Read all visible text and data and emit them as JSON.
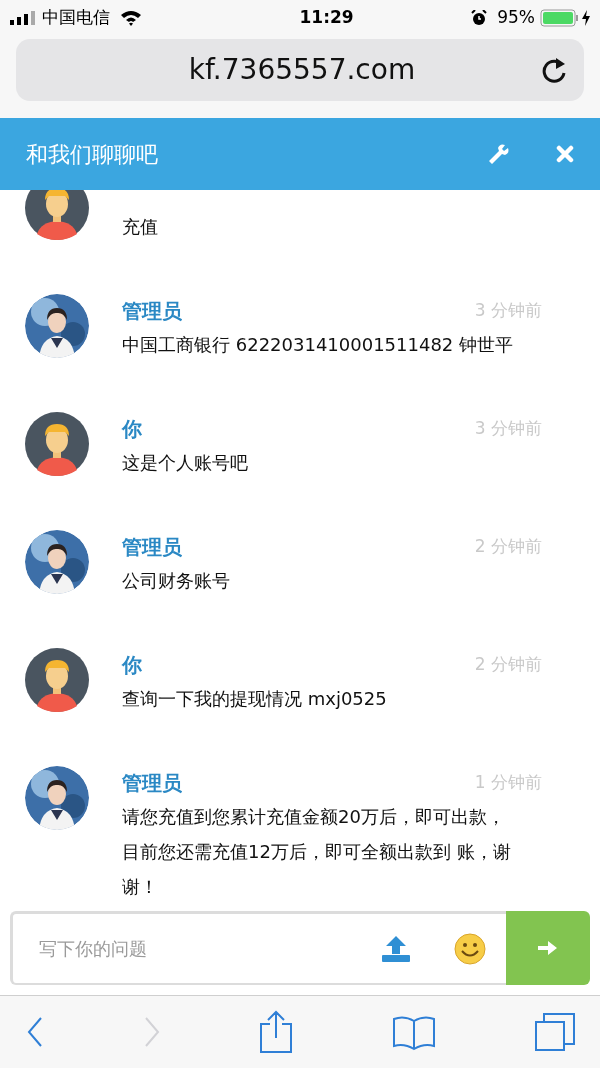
{
  "status_bar": {
    "carrier": "中国电信",
    "time": "11:29",
    "battery": "95%"
  },
  "address_bar": {
    "url": "kf.7365557.com"
  },
  "chat_header": {
    "title": "和我们聊聊吧"
  },
  "messages": [
    {
      "kind": "user",
      "text": "充值"
    },
    {
      "kind": "admin",
      "name": "管理员",
      "time": "3 分钟前",
      "text": "中国工商银行 6222031410001511482 钟世平"
    },
    {
      "kind": "user",
      "name": "你",
      "time": "3 分钟前",
      "text": "这是个人账号吧"
    },
    {
      "kind": "admin",
      "name": "管理员",
      "time": "2 分钟前",
      "text": "公司财务账号"
    },
    {
      "kind": "user",
      "name": "你",
      "time": "2 分钟前",
      "text": "查询一下我的提现情况 mxj0525"
    },
    {
      "kind": "admin",
      "name": "管理员",
      "time": "1 分钟前",
      "text": "请您充值到您累计充值金额20万后，即可出款，目前您还需充值12万后，即可全额出款到 账，谢谢！"
    }
  ],
  "composer": {
    "placeholder": "写下你的问题"
  },
  "toolbar": [
    {
      "kind": "back",
      "disabled": false
    },
    {
      "kind": "forward",
      "disabled": true
    },
    {
      "kind": "share",
      "disabled": false
    },
    {
      "kind": "bookmarks",
      "disabled": false
    },
    {
      "kind": "tabs",
      "disabled": false
    }
  ]
}
